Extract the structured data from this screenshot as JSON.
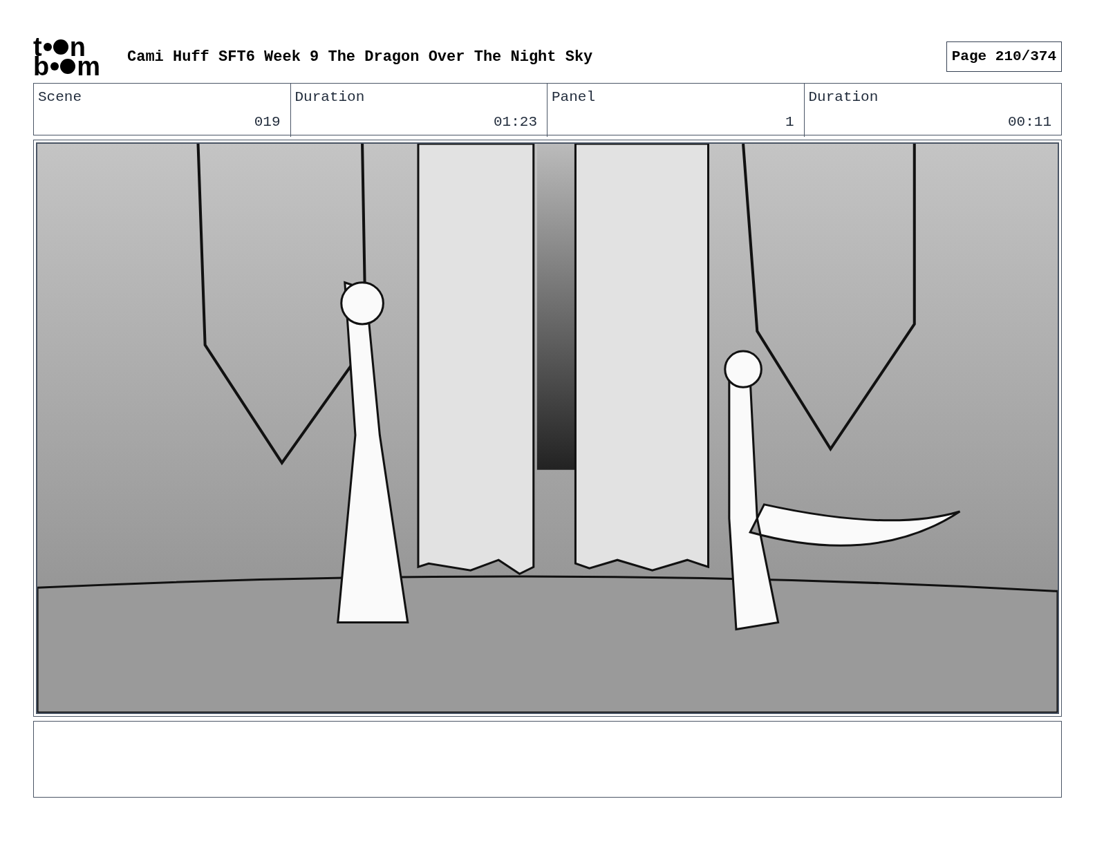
{
  "logo": {
    "row1": [
      "t",
      "n"
    ],
    "row2": [
      "b",
      "m"
    ]
  },
  "title": "Cami Huff SFT6 Week 9 The Dragon Over The Night Sky",
  "page": "Page 210/374",
  "fields": [
    {
      "label": "Scene",
      "value": "019"
    },
    {
      "label": "Duration",
      "value": "01:23"
    },
    {
      "label": "Panel",
      "value": "1"
    },
    {
      "label": "Duration",
      "value": "00:11"
    }
  ]
}
